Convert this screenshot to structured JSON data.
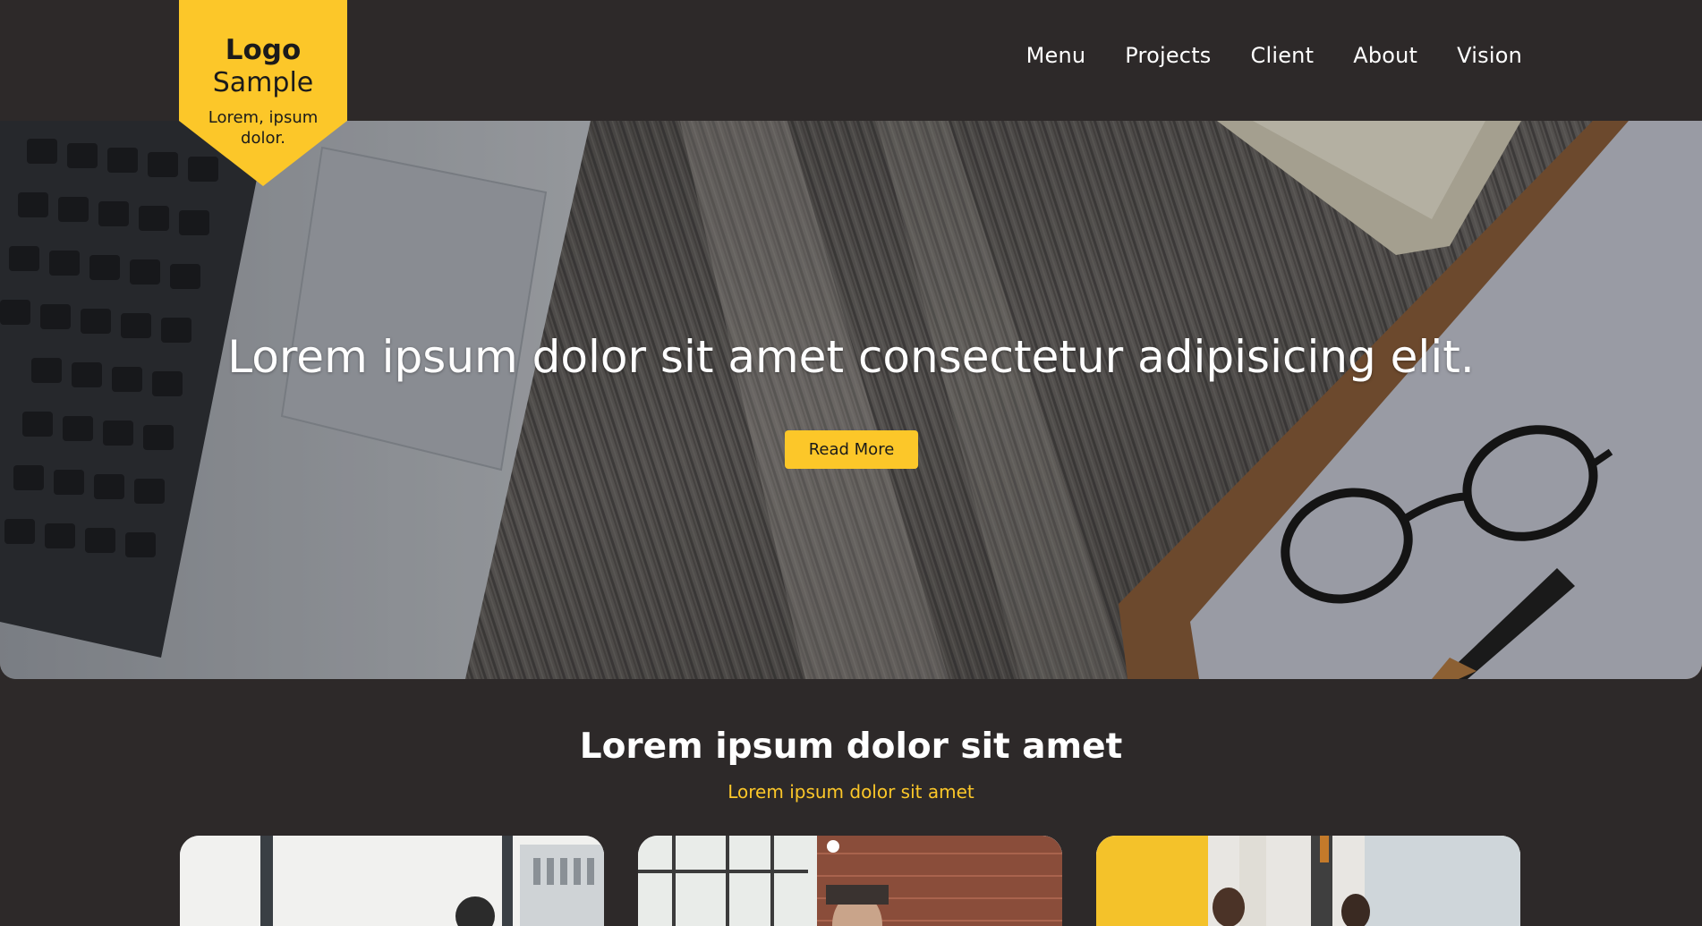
{
  "logo": {
    "title": "Logo",
    "subtitle": "Sample",
    "tagline": "Lorem, ipsum dolor."
  },
  "nav": {
    "items": [
      {
        "label": "Menu"
      },
      {
        "label": "Projects"
      },
      {
        "label": "Client"
      },
      {
        "label": "About"
      },
      {
        "label": "Vision"
      }
    ]
  },
  "hero": {
    "title": "Lorem ipsum dolor sit amet consectetur adipisicing elit.",
    "button_label": "Read More"
  },
  "section": {
    "title": "Lorem ipsum dolor sit amet",
    "subtitle": "Lorem ipsum dolor sit amet"
  },
  "colors": {
    "background": "#2d2929",
    "accent": "#fcc729",
    "text": "#ffffff"
  }
}
